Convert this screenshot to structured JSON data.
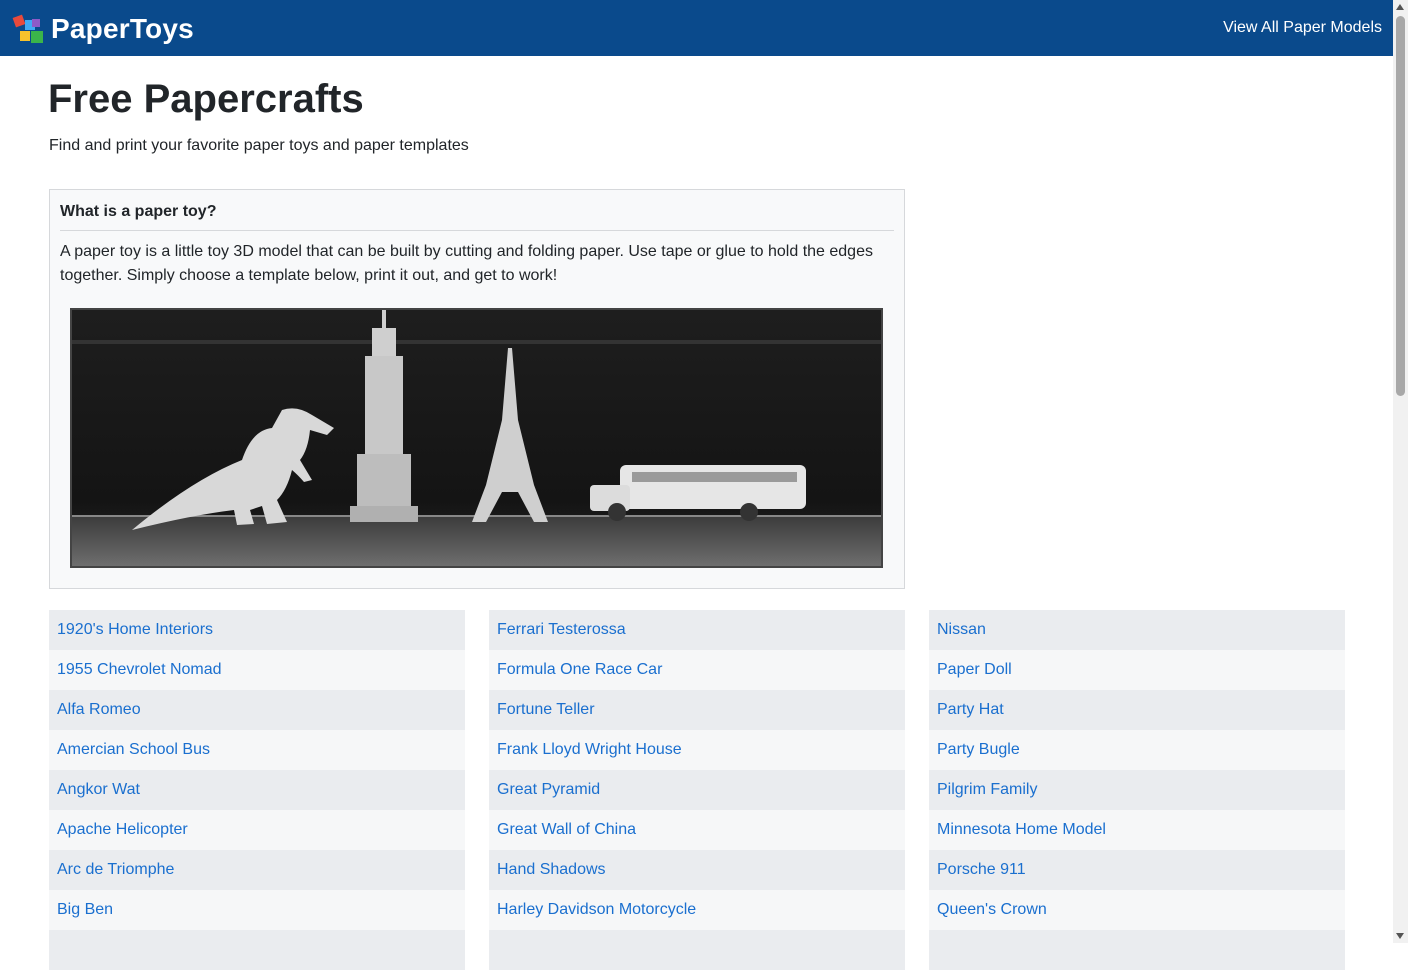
{
  "header": {
    "brand": "PaperToys",
    "nav_link": "View All Paper Models"
  },
  "page": {
    "title": "Free Papercrafts",
    "subtitle": "Find and print your favorite paper toys and paper templates"
  },
  "info_card": {
    "title": "What is a paper toy?",
    "text": "A paper toy is a little toy 3D model that can be built by cutting and folding paper. Use tape or glue to hold the edges together. Simply choose a template below, print it out, and get to work!",
    "image": "paper-models-photo"
  },
  "models": {
    "col1": [
      "1920's Home Interiors",
      "1955 Chevrolet Nomad",
      "Alfa Romeo",
      "Amercian School Bus",
      "Angkor Wat",
      "Apache Helicopter",
      "Arc de Triomphe",
      "Big Ben",
      ""
    ],
    "col2": [
      "Ferrari Testerossa",
      "Formula One Race Car",
      "Fortune Teller",
      "Frank Lloyd Wright House",
      "Great Pyramid",
      "Great Wall of China",
      "Hand Shadows",
      "Harley Davidson Motorcycle",
      ""
    ],
    "col3": [
      "Nissan",
      "Paper Doll",
      "Party Hat",
      "Party Bugle",
      "Pilgrim Family",
      "Minnesota Home Model",
      "Porsche 911",
      "Queen's Crown",
      ""
    ]
  },
  "colors": {
    "navbar": "#0a4a8c",
    "link": "#1a6fcf",
    "row_odd": "#eaecef",
    "row_even": "#f6f7f8"
  }
}
